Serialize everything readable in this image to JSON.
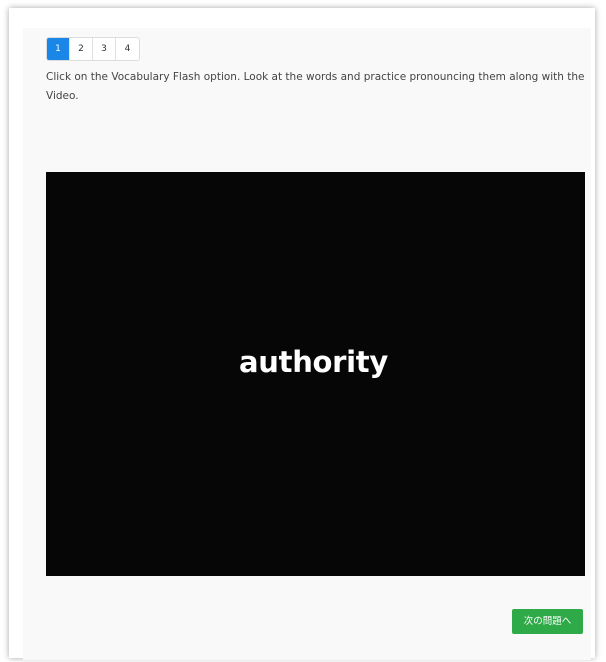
{
  "pagination": {
    "pages": [
      "1",
      "2",
      "3",
      "4"
    ],
    "active": "1"
  },
  "instruction": "Click on the Vocabulary Flash option.  Look at the words and practice pronouncing them along with the Video.",
  "video": {
    "word": "authority"
  },
  "next_button": {
    "label": "次の問題へ"
  },
  "colors": {
    "active_page": "#1a87e8",
    "next_button": "#2eaa48",
    "video_background": "#060606"
  }
}
